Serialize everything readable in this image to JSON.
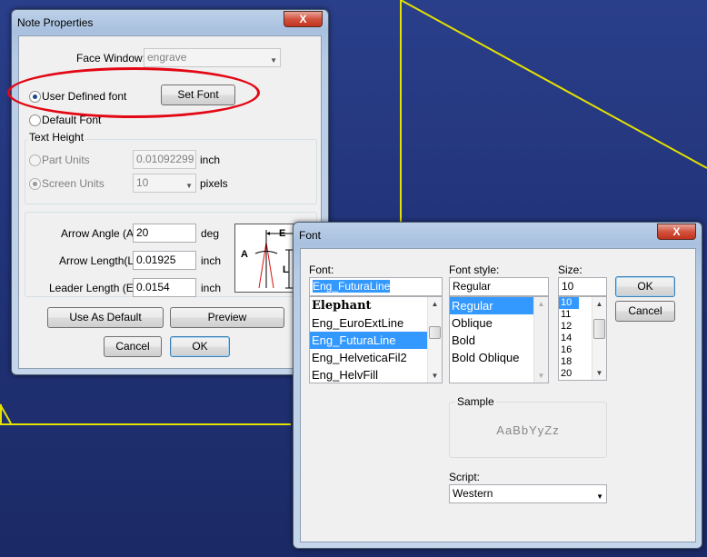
{
  "note_dialog": {
    "title": "Note Properties",
    "close": "X",
    "face_window_label": "Face Window:",
    "face_window_value": "engrave",
    "user_defined_font_label": "User Defined font",
    "set_font_label": "Set Font",
    "default_font_label": "Default Font",
    "text_height_group": "Text Height",
    "part_units_label": "Part Units",
    "part_units_value": "0.01092299",
    "part_units_unit": "inch",
    "screen_units_label": "Screen Units",
    "screen_units_value": "10",
    "screen_units_unit": "pixels",
    "arrow_angle_label": "Arrow Angle (A):",
    "arrow_angle_value": "20",
    "arrow_angle_unit": "deg",
    "arrow_length_label": "Arrow Length(L):",
    "arrow_length_value": "0.01925",
    "arrow_length_unit": "inch",
    "leader_length_label": "Leader Length (E):",
    "leader_length_value": "0.0154",
    "leader_length_unit": "inch",
    "diagram_e": "E",
    "diagram_a": "A",
    "diagram_l": "L",
    "use_as_default_label": "Use As Default",
    "preview_label": "Preview",
    "cancel_label": "Cancel",
    "ok_label": "OK"
  },
  "font_dialog": {
    "title": "Font",
    "close": "X",
    "font_label": "Font:",
    "font_value": "Eng_FuturaLine",
    "fonts": [
      {
        "name": "Elephant",
        "selected": false
      },
      {
        "name": "Eng_EuroExtLine",
        "selected": false
      },
      {
        "name": "Eng_FuturaLine",
        "selected": true
      },
      {
        "name": "Eng_HelveticaFil2",
        "selected": false
      },
      {
        "name": "Eng_HelvFill",
        "selected": false
      }
    ],
    "style_label": "Font style:",
    "style_value": "Regular",
    "styles": [
      {
        "name": "Regular",
        "selected": true
      },
      {
        "name": "Oblique",
        "selected": false
      },
      {
        "name": "Bold",
        "selected": false
      },
      {
        "name": "Bold Oblique",
        "selected": false
      }
    ],
    "size_label": "Size:",
    "size_value": "10",
    "sizes": [
      {
        "name": "10",
        "selected": true
      },
      {
        "name": "11",
        "selected": false
      },
      {
        "name": "12",
        "selected": false
      },
      {
        "name": "14",
        "selected": false
      },
      {
        "name": "16",
        "selected": false
      },
      {
        "name": "18",
        "selected": false
      },
      {
        "name": "20",
        "selected": false
      }
    ],
    "ok_label": "OK",
    "cancel_label": "Cancel",
    "sample_label": "Sample",
    "sample_text": "AaBbYyZz",
    "script_label": "Script:",
    "script_value": "Western"
  },
  "colors": {
    "desktop": "#22347a",
    "cad_line": "#e5e000",
    "highlight_ellipse": "#e30613",
    "selection": "#3399ff"
  },
  "icons": {
    "dropdown": "chevron-down-icon",
    "close": "close-icon",
    "scroll_up": "arrow-up-icon",
    "scroll_down": "arrow-down-icon"
  }
}
